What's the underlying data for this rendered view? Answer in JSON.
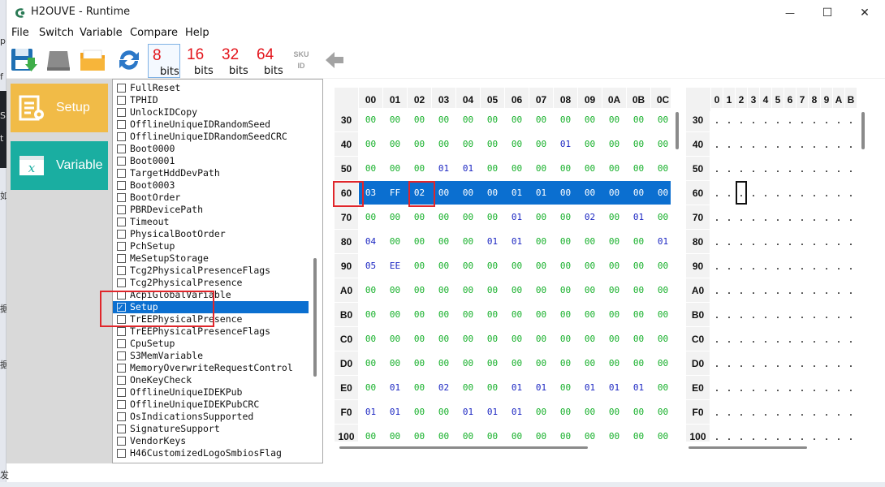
{
  "window": {
    "title": "H2OUVE - Runtime",
    "minimize_glyph": "—",
    "maximize_glyph": "☐",
    "close_glyph": "✕"
  },
  "menu": [
    "File",
    "Switch",
    "Variable",
    "Compare",
    "Help"
  ],
  "toolbar": {
    "bits": [
      {
        "num": "8",
        "label": "bits",
        "active": true
      },
      {
        "num": "16",
        "label": "bits",
        "active": false
      },
      {
        "num": "32",
        "label": "bits",
        "active": false
      },
      {
        "num": "64",
        "label": "bits",
        "active": false
      }
    ],
    "sku_line1": "SKU",
    "sku_line2": "ID"
  },
  "left_buttons": [
    {
      "label": "Setup",
      "color": "#f1bb47"
    },
    {
      "label": "Variable",
      "color": "#1aaea1"
    }
  ],
  "variables": [
    {
      "name": "FullReset",
      "checked": false
    },
    {
      "name": "TPHID",
      "checked": false
    },
    {
      "name": "UnlockIDCopy",
      "checked": false
    },
    {
      "name": "OfflineUniqueIDRandomSeed",
      "checked": false
    },
    {
      "name": "OfflineUniqueIDRandomSeedCRC",
      "checked": false
    },
    {
      "name": "Boot0000",
      "checked": false
    },
    {
      "name": "Boot0001",
      "checked": false
    },
    {
      "name": "TargetHddDevPath",
      "checked": false
    },
    {
      "name": "Boot0003",
      "checked": false
    },
    {
      "name": "BootOrder",
      "checked": false
    },
    {
      "name": "PBRDevicePath",
      "checked": false
    },
    {
      "name": "Timeout",
      "checked": false
    },
    {
      "name": "PhysicalBootOrder",
      "checked": false
    },
    {
      "name": "PchSetup",
      "checked": false
    },
    {
      "name": "MeSetupStorage",
      "checked": false
    },
    {
      "name": "Tcg2PhysicalPresenceFlags",
      "checked": false
    },
    {
      "name": "Tcg2PhysicalPresence",
      "checked": false
    },
    {
      "name": "AcpiGlobalVariable",
      "checked": false
    },
    {
      "name": "Setup",
      "checked": true
    },
    {
      "name": "TrEEPhysicalPresence",
      "checked": false
    },
    {
      "name": "TrEEPhysicalPresenceFlags",
      "checked": false
    },
    {
      "name": "CpuSetup",
      "checked": false
    },
    {
      "name": "S3MemVariable",
      "checked": false
    },
    {
      "name": "MemoryOverwriteRequestControl",
      "checked": false
    },
    {
      "name": "OneKeyCheck",
      "checked": false
    },
    {
      "name": "OfflineUniqueIDEKPub",
      "checked": false
    },
    {
      "name": "OfflineUniqueIDEKPubCRC",
      "checked": false
    },
    {
      "name": "OsIndicationsSupported",
      "checked": false
    },
    {
      "name": "SignatureSupport",
      "checked": false
    },
    {
      "name": "VendorKeys",
      "checked": false
    },
    {
      "name": "H46CustomizedLogoSmbiosFlag",
      "checked": false
    }
  ],
  "selected_variable": "Setup",
  "hex": {
    "columns": [
      "00",
      "01",
      "02",
      "03",
      "04",
      "05",
      "06",
      "07",
      "08",
      "09",
      "0A",
      "0B",
      "0C"
    ],
    "rows": [
      {
        "addr": "30",
        "values": [
          "00",
          "00",
          "00",
          "00",
          "00",
          "00",
          "00",
          "00",
          "00",
          "00",
          "00",
          "00",
          "00"
        ]
      },
      {
        "addr": "40",
        "values": [
          "00",
          "00",
          "00",
          "00",
          "00",
          "00",
          "00",
          "00",
          "01",
          "00",
          "00",
          "00",
          "00"
        ]
      },
      {
        "addr": "50",
        "values": [
          "00",
          "00",
          "00",
          "01",
          "01",
          "00",
          "00",
          "00",
          "00",
          "00",
          "00",
          "00",
          "00"
        ]
      },
      {
        "addr": "60",
        "values": [
          "03",
          "FF",
          "02",
          "00",
          "00",
          "00",
          "01",
          "01",
          "00",
          "00",
          "00",
          "00",
          "00"
        ],
        "selected": true
      },
      {
        "addr": "70",
        "values": [
          "00",
          "00",
          "00",
          "00",
          "00",
          "00",
          "01",
          "00",
          "00",
          "02",
          "00",
          "01",
          "00"
        ]
      },
      {
        "addr": "80",
        "values": [
          "04",
          "00",
          "00",
          "00",
          "00",
          "01",
          "01",
          "00",
          "00",
          "00",
          "00",
          "00",
          "01"
        ]
      },
      {
        "addr": "90",
        "values": [
          "05",
          "EE",
          "00",
          "00",
          "00",
          "00",
          "00",
          "00",
          "00",
          "00",
          "00",
          "00",
          "00"
        ]
      },
      {
        "addr": "A0",
        "values": [
          "00",
          "00",
          "00",
          "00",
          "00",
          "00",
          "00",
          "00",
          "00",
          "00",
          "00",
          "00",
          "00"
        ]
      },
      {
        "addr": "B0",
        "values": [
          "00",
          "00",
          "00",
          "00",
          "00",
          "00",
          "00",
          "00",
          "00",
          "00",
          "00",
          "00",
          "00"
        ]
      },
      {
        "addr": "C0",
        "values": [
          "00",
          "00",
          "00",
          "00",
          "00",
          "00",
          "00",
          "00",
          "00",
          "00",
          "00",
          "00",
          "00"
        ]
      },
      {
        "addr": "D0",
        "values": [
          "00",
          "00",
          "00",
          "00",
          "00",
          "00",
          "00",
          "00",
          "00",
          "00",
          "00",
          "00",
          "00"
        ]
      },
      {
        "addr": "E0",
        "values": [
          "00",
          "01",
          "00",
          "02",
          "00",
          "00",
          "01",
          "01",
          "00",
          "01",
          "01",
          "01",
          "00"
        ]
      },
      {
        "addr": "F0",
        "values": [
          "01",
          "01",
          "00",
          "00",
          "01",
          "01",
          "01",
          "00",
          "00",
          "00",
          "00",
          "00",
          "00"
        ]
      },
      {
        "addr": "100",
        "values": [
          "00",
          "00",
          "00",
          "00",
          "00",
          "00",
          "00",
          "00",
          "00",
          "00",
          "00",
          "00",
          "00"
        ]
      }
    ],
    "colors": {
      "zero": "#17b02b",
      "nonzero": "#1c27c2",
      "selection": "#0b6fd0",
      "highlight_box": "#e0262b"
    }
  },
  "ascii": {
    "columns": [
      "0",
      "1",
      "2",
      "3",
      "4",
      "5",
      "6",
      "7",
      "8",
      "9",
      "A",
      "B"
    ],
    "rows": [
      "30",
      "40",
      "50",
      "60",
      "70",
      "80",
      "90",
      "A0",
      "B0",
      "C0",
      "D0",
      "E0",
      "F0",
      "100"
    ],
    "cell": "."
  },
  "background_glyphs": [
    "p",
    "f",
    "S",
    "t",
    "如",
    "据",
    "据",
    "发"
  ],
  "icons": [
    "save-icon",
    "device-icon",
    "folder-icon",
    "refresh-icon",
    "back-arrow-icon",
    "app-icon",
    "setup-icon",
    "variable-icon"
  ]
}
